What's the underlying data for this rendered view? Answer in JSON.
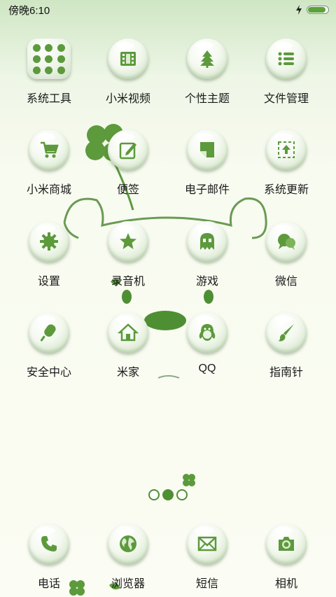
{
  "status_bar": {
    "time": "傍晚6:10",
    "battery_percent": 90
  },
  "colors": {
    "accent": "#4e8f34",
    "icon_green": "#5c9a3c"
  },
  "apps": [
    {
      "label": "系统工具",
      "icon": "folder-grid-icon"
    },
    {
      "label": "小米视频",
      "icon": "film-icon"
    },
    {
      "label": "个性主题",
      "icon": "tree-icon"
    },
    {
      "label": "文件管理",
      "icon": "list-icon"
    },
    {
      "label": "小米商城",
      "icon": "cart-icon"
    },
    {
      "label": "便签",
      "icon": "note-edit-icon"
    },
    {
      "label": "电子邮件",
      "icon": "mail-page-icon"
    },
    {
      "label": "系统更新",
      "icon": "upload-box-icon"
    },
    {
      "label": "设置",
      "icon": "gear-icon"
    },
    {
      "label": "录音机",
      "icon": "star-icon"
    },
    {
      "label": "游戏",
      "icon": "ghost-icon"
    },
    {
      "label": "微信",
      "icon": "chat-bubbles-icon"
    },
    {
      "label": "安全中心",
      "icon": "popsicle-icon"
    },
    {
      "label": "米家",
      "icon": "home-icon"
    },
    {
      "label": "QQ",
      "icon": "penguin-icon"
    },
    {
      "label": "指南针",
      "icon": "brush-icon"
    }
  ],
  "dock": [
    {
      "label": "电话",
      "icon": "phone-icon"
    },
    {
      "label": "浏览器",
      "icon": "globe-icon"
    },
    {
      "label": "短信",
      "icon": "envelope-icon"
    },
    {
      "label": "相机",
      "icon": "camera-icon"
    }
  ],
  "page_indicator": {
    "pages": 3,
    "current": 2
  }
}
